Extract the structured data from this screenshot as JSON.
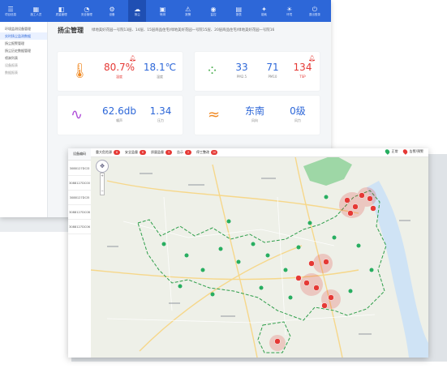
{
  "nav": {
    "items": [
      {
        "icon": "☰",
        "label": "项目信息"
      },
      {
        "icon": "▦",
        "label": "施工人员"
      },
      {
        "icon": "◧",
        "label": "质量管理"
      },
      {
        "icon": "◔",
        "label": "安全管理"
      },
      {
        "icon": "⚙",
        "label": "设备"
      },
      {
        "icon": "☁",
        "label": "扬尘"
      },
      {
        "icon": "▣",
        "label": "喷淋"
      },
      {
        "icon": "⚠",
        "label": "报警"
      },
      {
        "icon": "◉",
        "label": "监控"
      },
      {
        "icon": "▤",
        "label": "报表"
      },
      {
        "icon": "✦",
        "label": "能耗"
      },
      {
        "icon": "☀",
        "label": "环境"
      },
      {
        "icon": "⏻",
        "label": "退出登录"
      }
    ]
  },
  "sidebar": {
    "items": [
      "环境监测设备管理",
      "实时扬尘监测数据",
      "扬尘报警管理",
      "扬尘历史数据管理",
      "喷淋列表",
      "设备报表",
      "数据报表"
    ]
  },
  "main": {
    "title": "扬尘管理",
    "breadcrumb": "绿地美好花园一号院13层、14层、15层商品住宅/绿地美好花园一号院15层、20层商品住宅/绿地美好花园一号院16"
  },
  "cards": {
    "temp_humidity": {
      "icon": "🌡",
      "humidity": "80.7%",
      "humidity_label": "湿度",
      "temp": "18.1℃",
      "temp_label": "温度"
    },
    "particulate": {
      "icon": "⁘",
      "pm25": "33",
      "pm25_label": "PM2.5",
      "pm10": "71",
      "pm10_label": "PM10",
      "tsp": "134",
      "tsp_label": "TSP"
    },
    "noise_pressure": {
      "icon": "∿",
      "noise": "62.6db",
      "noise_label": "噪声",
      "pressure": "1.34",
      "pressure_label": "压力"
    },
    "wind": {
      "icon": "≈",
      "direction": "东南",
      "direction_label": "风向",
      "level": "0级",
      "level_label": "风力"
    }
  },
  "colors": {
    "nav_bg": "#2d67d8",
    "alarm": "#e53935",
    "normal_pin": "#27ae60",
    "value_blue": "#2d67d8",
    "value_red": "#e53935"
  },
  "table": {
    "header": "设备编码",
    "rows": [
      "3088127DCI3",
      "3088127DC00",
      "3088127DCI5",
      "3088127DC08",
      "3088127DC06"
    ]
  },
  "map": {
    "toolbar": [
      {
        "label": "重大危险源",
        "count": "8"
      },
      {
        "label": "安全监督",
        "count": "6"
      },
      {
        "label": "质量监督",
        "count": "3"
      },
      {
        "label": "告示",
        "count": "2"
      },
      {
        "label": "停工整改",
        "count": "10"
      }
    ],
    "legend_normal": "正常",
    "legend_alarm": "告警/预警",
    "zoom_in": "+",
    "zoom_out": "−"
  }
}
